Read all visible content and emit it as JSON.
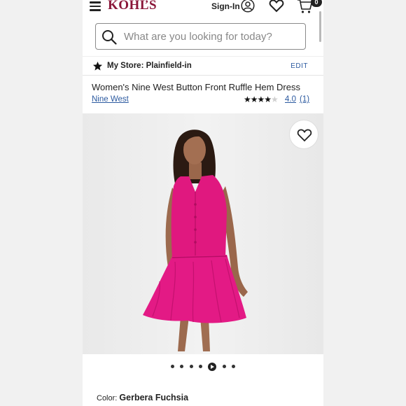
{
  "header": {
    "logo": "KOHĽS",
    "signin_label": "Sign-In",
    "cart_count": "0"
  },
  "search": {
    "placeholder": "What are you looking for today?"
  },
  "store": {
    "label": "My Store: Plainfield-in",
    "edit_label": "EDIT"
  },
  "product": {
    "title": "Women's Nine West Button Front Ruffle Hem Dress",
    "brand": "Nine West",
    "rating_value": "4.0",
    "rating_count": "(1)",
    "rating_stars": 4,
    "color_label": "Color:",
    "color_value": "Gerbera Fuchsia"
  },
  "carousel": {
    "total_slides": 7,
    "active_slide": 5
  },
  "colors": {
    "brand": "#8a1538",
    "link": "#2c5aa0",
    "dress": "#e0187f"
  }
}
